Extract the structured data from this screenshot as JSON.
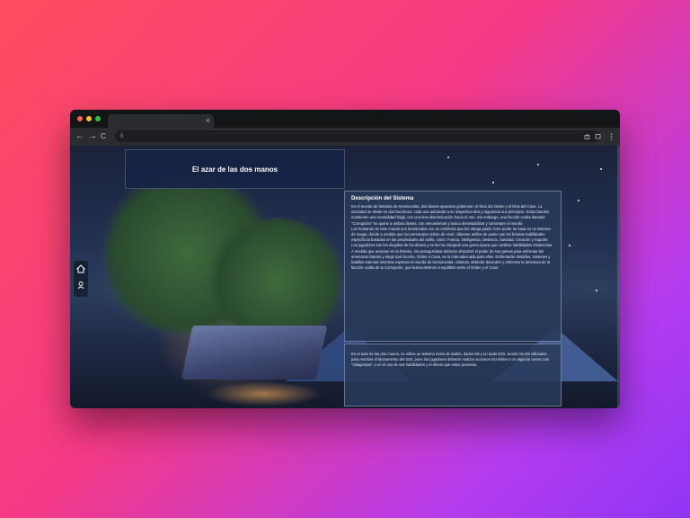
{
  "colors": {
    "close": "#ff5f57",
    "minimize": "#febc2e",
    "maximize": "#28c840"
  },
  "browser": {
    "tab_close": "×",
    "back": "←",
    "forward": "→",
    "reload": "C",
    "url": "ii"
  },
  "icons": {
    "share": "share-icon",
    "extensions": "puzzle-icon",
    "menu": "kebab-menu-icon",
    "home": "home-icon",
    "user": "user-icon"
  },
  "page": {
    "title": "El azar de las dos manos",
    "description": {
      "heading": "Descripción del Sistema",
      "paragraphs": [
        "En el mundo de fantasía de Kensocontia, dos dioses opuestos gobiernan: el Dios del Orden y el Dios del Caos. La sociedad se divide en dos facciones, cada una adorando a su respectivo dios y siguiendo sus principios. Estos bandos mantienen una neutralidad frágil, con una leve discriminación hacia el otro. Sin embargo, una facción oculta llamada \"Corrupción\" se opone a ambos dioses, con mecanismos y busca desestabilizar y corromper el mundo.",
        "Los humanos de este mundo son bendecidos con un emblema que les otorga poder. Este poder se basa en un sistema de magia, donde a medida que los personajes suben de nivel, obtienen anillos de poder que les brindan habilidades específicas basadas en las propiedades del anillo, como: Fuerza, Inteligencia, Destreza, Sanidad, Creación y Soporte.",
        "Los jugadores son los elegidos de los dioses y se les ha otorgado una gema opaca que confiere habilidades misteriosas. A medida que avanzan en la historia, los protagonistas deberán descubrir el poder de sus gemas para enfrentar las amenazas futuras y elegir qué facción, Orden o Caos, es la más adecuada para ellos. Enfrentarán desafíos, misiones y batallas internas mientras exploran el mundo de Kensocontia. Además, deberán descubrir y enfrentar la amenaza de la facción oculta de la Corrupción, que busca destruir el equilibrio entre el Orden y el Caos."
      ]
    },
    "rules_text": "En el azar de las dos manos, se utiliza un sistema mixto de dados, dados D6 y un dado D20, siendo los D6 utilizados para resolver el lanzamiento del D20, pues los jugadores deberán realizar acciones increíbles o en algunos casos casi \"milagrosas\", o en el uso de sus habilidades y el efecto que estos presenta."
  }
}
